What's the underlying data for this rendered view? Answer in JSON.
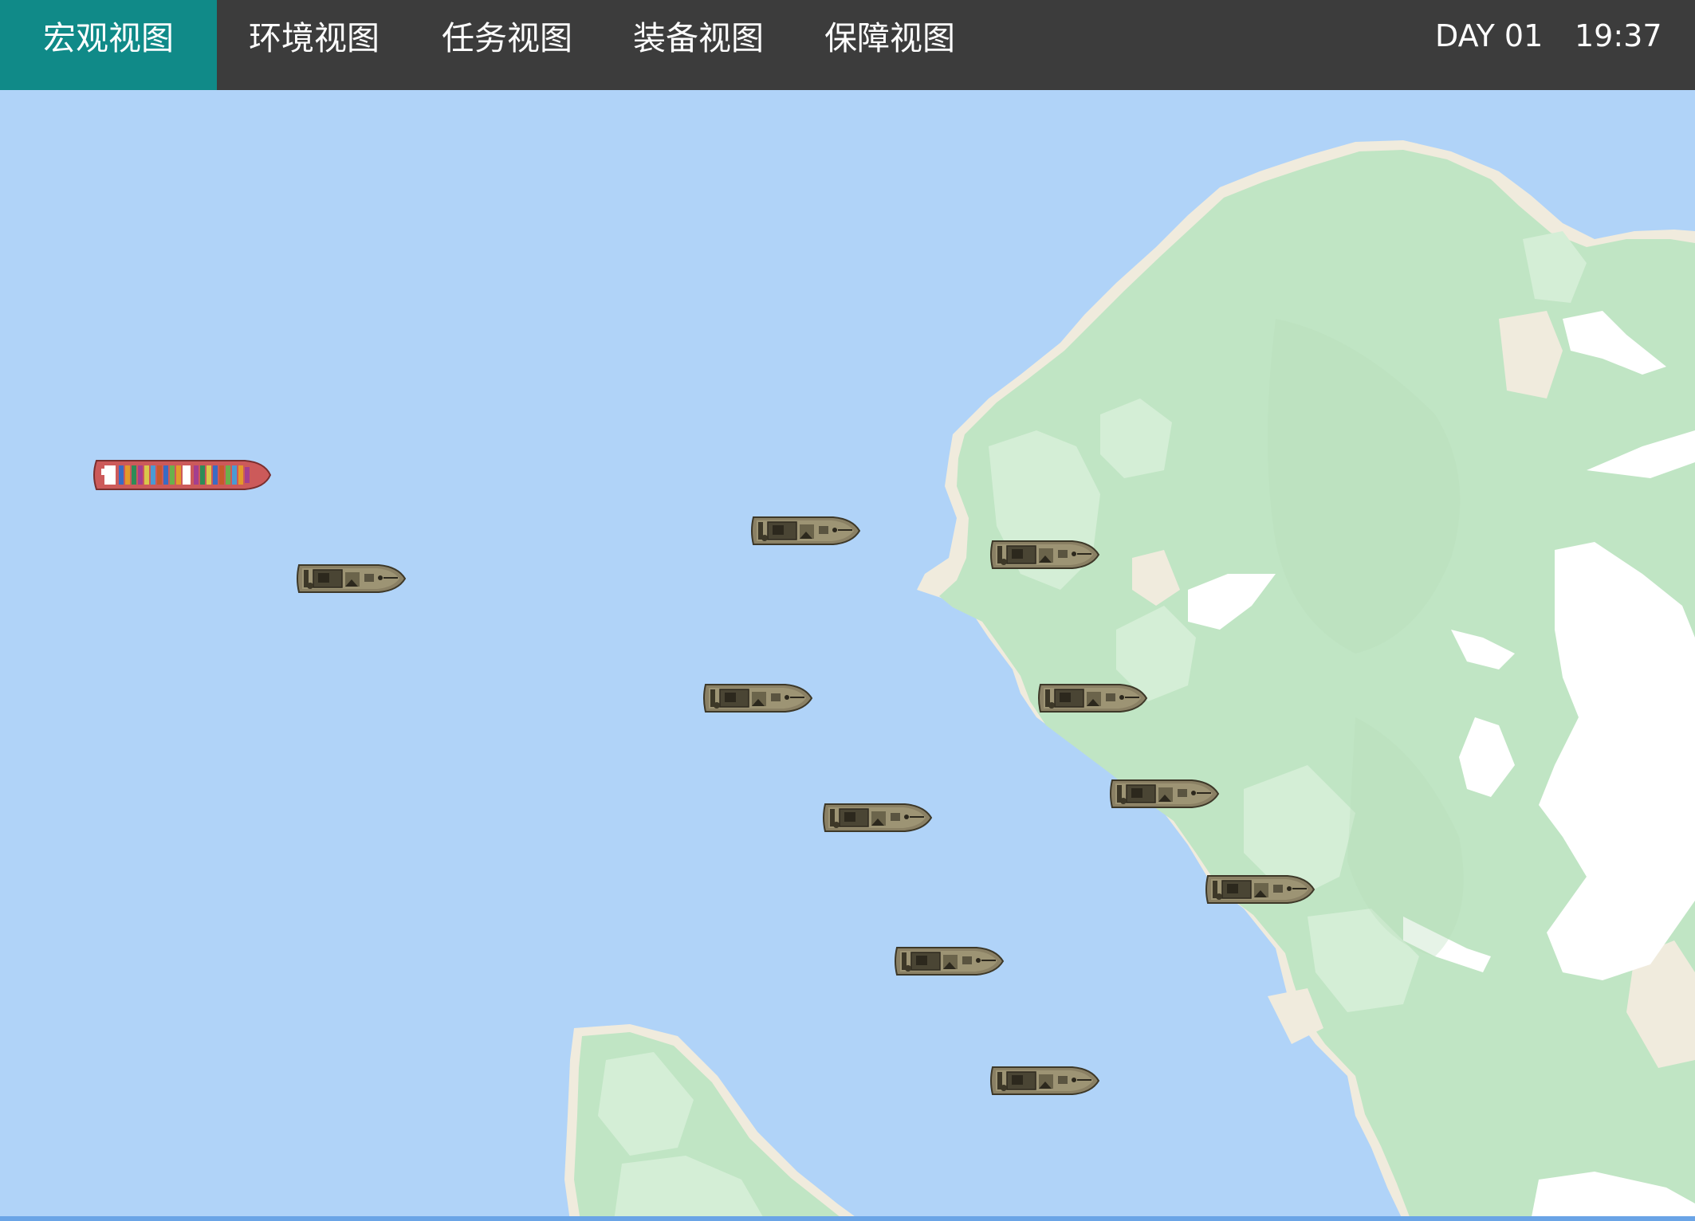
{
  "nav": {
    "tabs": [
      {
        "label": "宏观视图",
        "active": true
      },
      {
        "label": "环境视图",
        "active": false
      },
      {
        "label": "任务视图",
        "active": false
      },
      {
        "label": "装备视图",
        "active": false
      },
      {
        "label": "保障视图",
        "active": false
      }
    ]
  },
  "clock": {
    "day": "DAY 01",
    "time": "19:37"
  },
  "map": {
    "colors": {
      "water": "#b0d3f8",
      "land": "#c0e5c4",
      "land_light": "#d4eed6",
      "beach": "#f0ebdd",
      "snow": "#ffffff",
      "accent": "#108a88",
      "header": "#3c3c3c"
    },
    "units": {
      "cargo_ship": {
        "name": "container-ship",
        "color": "#cc5a5a"
      },
      "boats_count": 10
    }
  }
}
